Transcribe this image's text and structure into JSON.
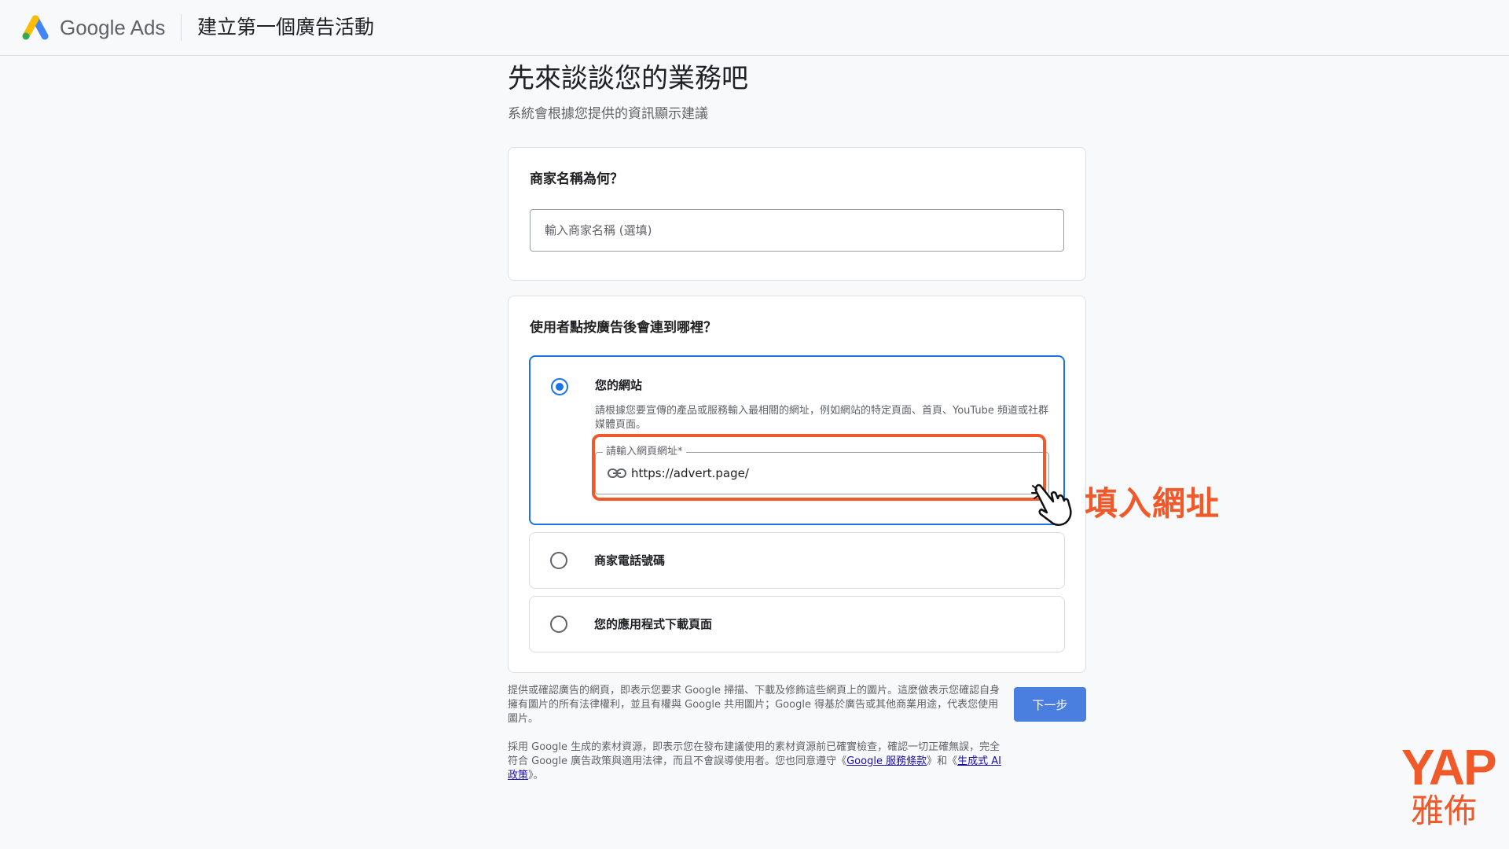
{
  "header": {
    "brand": "Google Ads",
    "page_title": "建立第一個廣告活動"
  },
  "intro": {
    "heading": "先來談談您的業務吧",
    "subheading": "系統會根據您提供的資訊顯示建議"
  },
  "business_name": {
    "question": "商家名稱為何？",
    "placeholder": "輸入商家名稱 (選填)",
    "value": ""
  },
  "destination": {
    "question": "使用者點按廣告後會連到哪裡？",
    "options": [
      {
        "label": "您的網站",
        "selected": true,
        "description": "請根據您要宣傳的產品或服務輸入最相關的網址，例如網站的特定頁面、首頁、YouTube 頻道或社群媒體頁面。",
        "field_label": "請輸入網頁網址*",
        "field_value": "https://advert.page/"
      },
      {
        "label": "商家電話號碼",
        "selected": false
      },
      {
        "label": "您的應用程式下載頁面",
        "selected": false
      }
    ]
  },
  "annotation": {
    "callout": "填入網址",
    "color": "#f0592a"
  },
  "footer": {
    "notice1": "提供或確認廣告的網頁，即表示您要求 Google 掃描、下載及修飾這些網頁上的圖片。這麼做表示您確認自身擁有圖片的所有法律權利，並且有權與 Google 共用圖片；Google 得基於廣告或其他商業用途，代表您使用圖片。",
    "notice2_prefix": "採用 Google 生成的素材資源，即表示您在發布建議使用的素材資源前已確實檢查，確認一切正確無誤，完全符合 Google 廣告政策與適用法律，而且不會誤導使用者。您也同意遵守《",
    "terms_link": "Google 服務條款",
    "notice2_mid": "》和《",
    "ai_policy_link": "生成式 AI 政策",
    "notice2_suffix": "》。",
    "next_button": "下一步"
  },
  "watermark": {
    "top": "YAP",
    "bottom": "雅佈"
  },
  "colors": {
    "accent_blue": "#1a73e8",
    "button_blue": "#4a7fe0",
    "annotation_orange": "#f0592a"
  }
}
